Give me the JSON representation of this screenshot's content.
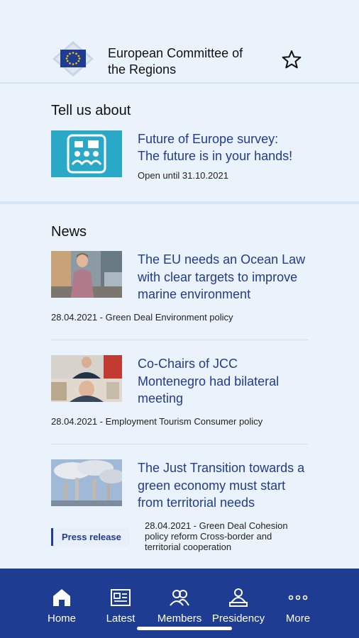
{
  "header": {
    "title_line1": "European Committee of",
    "title_line2": "the Regions",
    "logo_icon": "eu-flag-icon",
    "favourite_icon": "star-outline-icon"
  },
  "tell_us": {
    "title": "Tell us about",
    "survey": {
      "title_line1": "Future of Europe survey:",
      "title_line2": "The future is in your hands!",
      "meta": "Open until 31.10.2021",
      "icon": "discussion-icon"
    }
  },
  "news": {
    "title": "News",
    "items": [
      {
        "title_lines": [
          "The EU needs an Ocean Law",
          "with clear targets to improve",
          "marine environment"
        ],
        "meta": "28.04.2021 - Green Deal Environment policy"
      },
      {
        "title_lines": [
          "Co-Chairs of JCC",
          "Montenegro had bilateral",
          "meeting"
        ],
        "meta": "28.04.2021 - Employment Tourism Consumer policy"
      },
      {
        "title_lines": [
          "The Just Transition towards a",
          "green economy must start",
          "from territorial needs"
        ],
        "badge": "Press release",
        "meta_lines": [
          "28.04.2021 - Green Deal Cohesion",
          "policy reform Cross-border and",
          "territorial cooperation"
        ]
      }
    ]
  },
  "tabbar": {
    "tabs": [
      {
        "label": "Home",
        "icon": "home-icon"
      },
      {
        "label": "Latest",
        "icon": "newspaper-icon"
      },
      {
        "label": "Members",
        "icon": "people-icon"
      },
      {
        "label": "Presidency",
        "icon": "presidency-icon"
      },
      {
        "label": "More",
        "icon": "more-dots-icon"
      }
    ]
  },
  "colors": {
    "background": "#eaf3fb",
    "accent": "#223a8f",
    "tabbar": "#1f3c93",
    "survey_thumb": "#2aa8c8"
  }
}
